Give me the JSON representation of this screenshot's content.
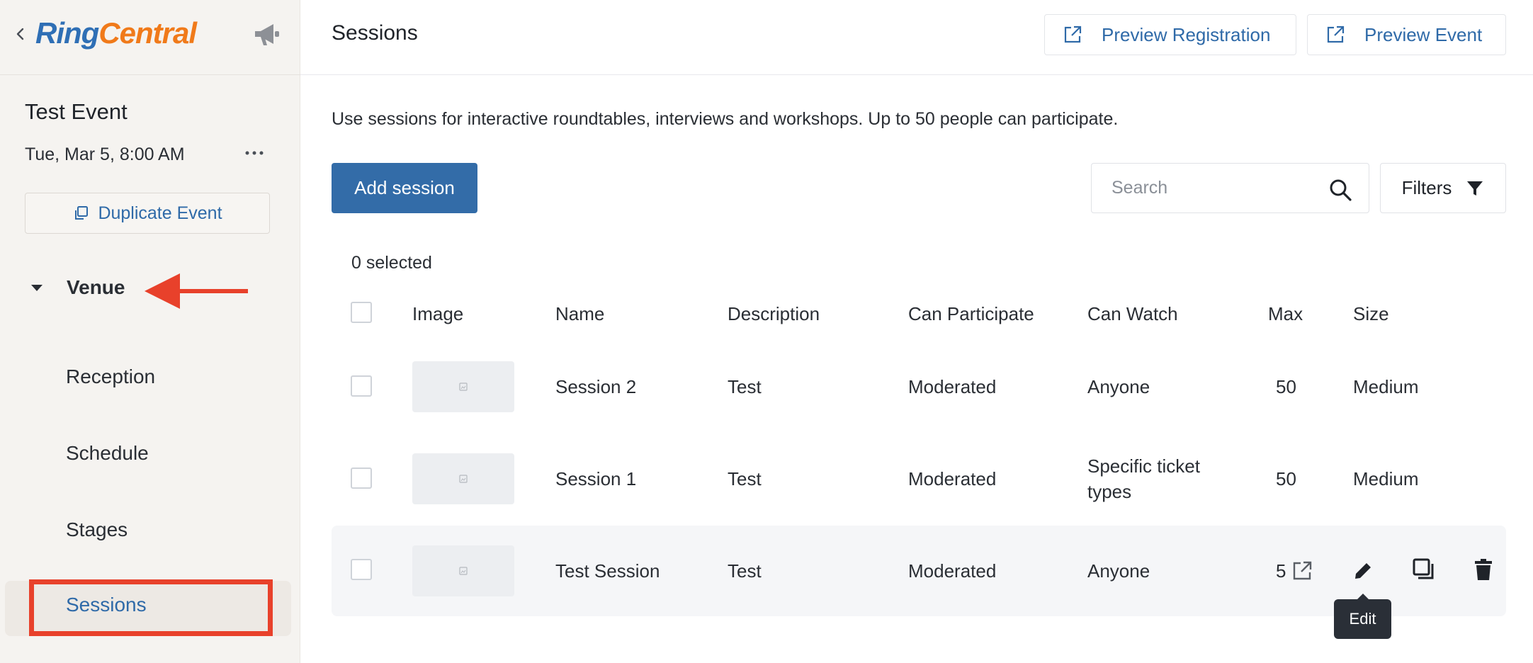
{
  "brand": {
    "logo_part1": "Ring",
    "logo_part2": "Central"
  },
  "sidebar": {
    "event_title": "Test Event",
    "event_date": "Tue, Mar 5, 8:00 AM",
    "duplicate_label": "Duplicate Event",
    "section_label": "Venue",
    "items": [
      {
        "label": "Reception"
      },
      {
        "label": "Schedule"
      },
      {
        "label": "Stages"
      },
      {
        "label": "Sessions",
        "active": true
      }
    ]
  },
  "header": {
    "title": "Sessions",
    "preview_registration": "Preview Registration",
    "preview_event": "Preview Event"
  },
  "main": {
    "intro": "Use sessions for interactive roundtables, interviews and workshops. Up to 50 people can participate.",
    "add_label": "Add session",
    "search_placeholder": "Search",
    "filters_label": "Filters",
    "selected_count": "0 selected"
  },
  "table": {
    "columns": [
      "Image",
      "Name",
      "Description",
      "Can Participate",
      "Can Watch",
      "Max",
      "Size"
    ],
    "rows": [
      {
        "name": "Session 2",
        "description": "Test",
        "can_participate": "Moderated",
        "can_watch": "Anyone",
        "max": "50",
        "size": "Medium"
      },
      {
        "name": "Session 1",
        "description": "Test",
        "can_participate": "Moderated",
        "can_watch_line1": "Specific ticket",
        "can_watch_line2": "types",
        "max": "50",
        "size": "Medium"
      },
      {
        "name": "Test Session",
        "description": "Test",
        "can_participate": "Moderated",
        "can_watch": "Anyone",
        "max": "5"
      }
    ]
  },
  "tooltip": {
    "text": "Edit"
  },
  "colors": {
    "accent": "#336ca8",
    "link": "#2f6aa8",
    "logo_blue": "#2f6fb5",
    "logo_orange": "#f07a1a",
    "annotation_red": "#e8412b"
  },
  "icons": [
    "chevron-left-icon",
    "megaphone-icon",
    "more-horizontal-icon",
    "copy-icon",
    "caret-down-icon",
    "external-link-icon",
    "search-icon",
    "filter-icon",
    "image-placeholder-icon",
    "pencil-icon",
    "duplicate-icon",
    "trash-icon"
  ]
}
